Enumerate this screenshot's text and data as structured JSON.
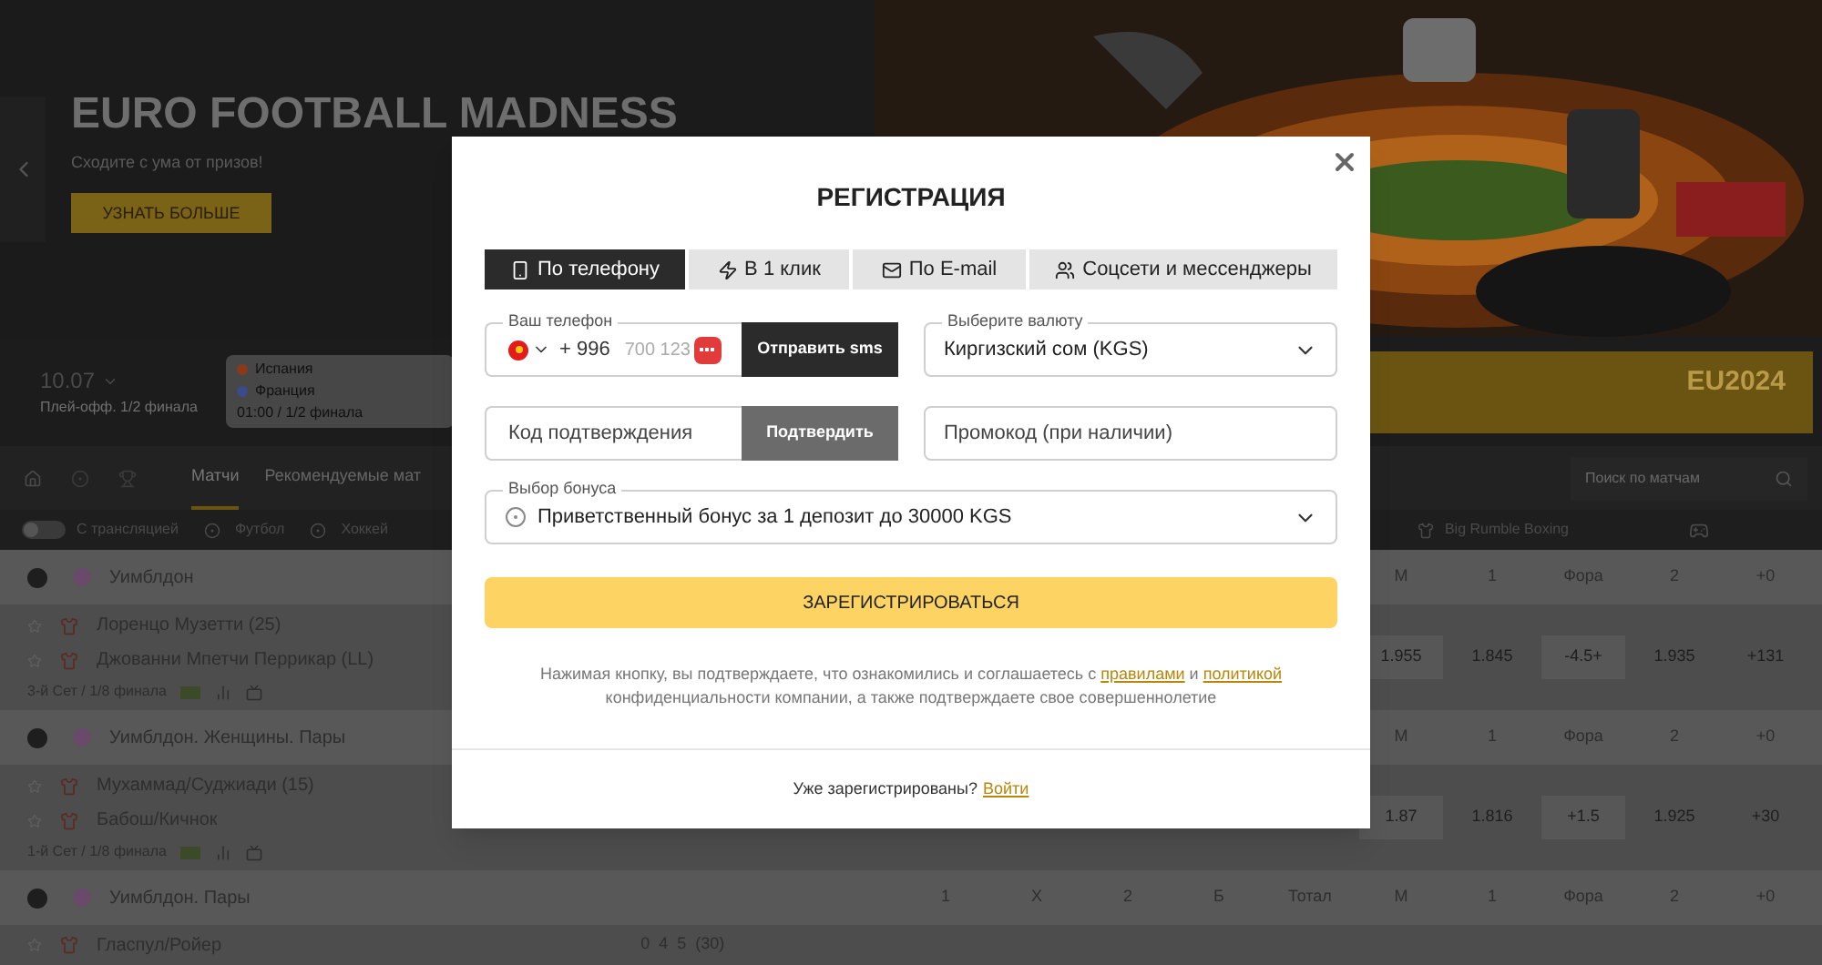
{
  "banner": {
    "title": "EURO FOOTBALL MADNESS",
    "subtitle": "Сходите с ума от призов!",
    "button": "УЗНАТЬ БОЛЬШЕ"
  },
  "strip": {
    "date": "10.07",
    "stage": "Плей-офф. 1/2 финала",
    "match": {
      "team_1": "Испания",
      "team_2": "Франция",
      "info": "01:00 / 1/2 финала"
    },
    "promo": "EU2024"
  },
  "nav": {
    "tabs": [
      {
        "label": "Матчи",
        "selected": true
      },
      {
        "label": "Рекомендуемые мат",
        "selected": false
      }
    ],
    "search": {
      "placeholder": "Поиск по матчам"
    }
  },
  "filters": {
    "toggle": {
      "label": "С трансляцией",
      "on": false
    },
    "sports": [
      "Футбол",
      "Хоккей"
    ],
    "right_item": "Big Rumble Boxing"
  },
  "groups": [
    {
      "name": "Уимблдон",
      "columns": [
        "М",
        "1",
        "Фора",
        "2",
        "+0"
      ],
      "match": {
        "teams": [
          "Лоренцо Музетти (25)",
          "Джованни Мпетчи Перрикар (LL)"
        ],
        "info": "3-й Сет / 1/8 финала",
        "odds": [
          "1.955",
          "1.845",
          "-4.5+",
          "1.935",
          "+131"
        ]
      }
    },
    {
      "name": "Уимблдон. Женщины. Пары",
      "columns": [
        "М",
        "1",
        "Фора",
        "2",
        "+0"
      ],
      "match": {
        "teams": [
          "Мухаммад/Суджиади (15)",
          "Бабош/Кичнок"
        ],
        "info": "1-й Сет / 1/8 финала",
        "odds": [
          "1.87",
          "1.816",
          "+1.5",
          "1.925",
          "+30"
        ]
      }
    },
    {
      "name": "Уимблдон. Пары",
      "columns": [
        "1",
        "Х",
        "2",
        "Б",
        "Тотал",
        "М",
        "1",
        "Фора",
        "2",
        "+0"
      ],
      "match": {
        "teams": [
          "Гласпул/Ройер"
        ],
        "score": "0  4  5  (30)"
      }
    }
  ],
  "modal": {
    "title": "РЕГИСТРАЦИЯ",
    "tabs": [
      {
        "label": "По телефону",
        "selected": true
      },
      {
        "label": "В 1 клик",
        "selected": false
      },
      {
        "label": "По E-mail",
        "selected": false
      },
      {
        "label": "Соцсети и мессенджеры",
        "selected": false
      }
    ],
    "phone": {
      "label": "Ваш телефон",
      "code": "+ 996",
      "placeholder": "700 123",
      "button": "Отправить sms"
    },
    "currency": {
      "label": "Выберите валюту",
      "value": "Киргизский сом (KGS)"
    },
    "confirm": {
      "placeholder": "Код подтверждения",
      "button": "Подтвердить",
      "disabled": true
    },
    "promo": {
      "placeholder": "Промокод (при наличии)"
    },
    "bonus": {
      "label": "Выбор бонуса",
      "value": "Приветственный бонус за 1 депозит до 30000 KGS"
    },
    "submit": "ЗАРЕГИСТРИРОВАТЬСЯ",
    "terms": [
      {
        "kind": "text",
        "text": "Нажимая кнопку, вы подтверждаете, что ознакомились и соглашаетесь с "
      },
      {
        "kind": "link",
        "text": "правилами"
      },
      {
        "kind": "text",
        "text": " и "
      },
      {
        "kind": "link",
        "text": "политикой"
      },
      {
        "kind": "text",
        "text": " конфиденциальности компании, а также подтверждаете свое совершеннолетие"
      }
    ],
    "footer": {
      "text": "Уже зарегистрированы?",
      "link": "Войти"
    }
  }
}
